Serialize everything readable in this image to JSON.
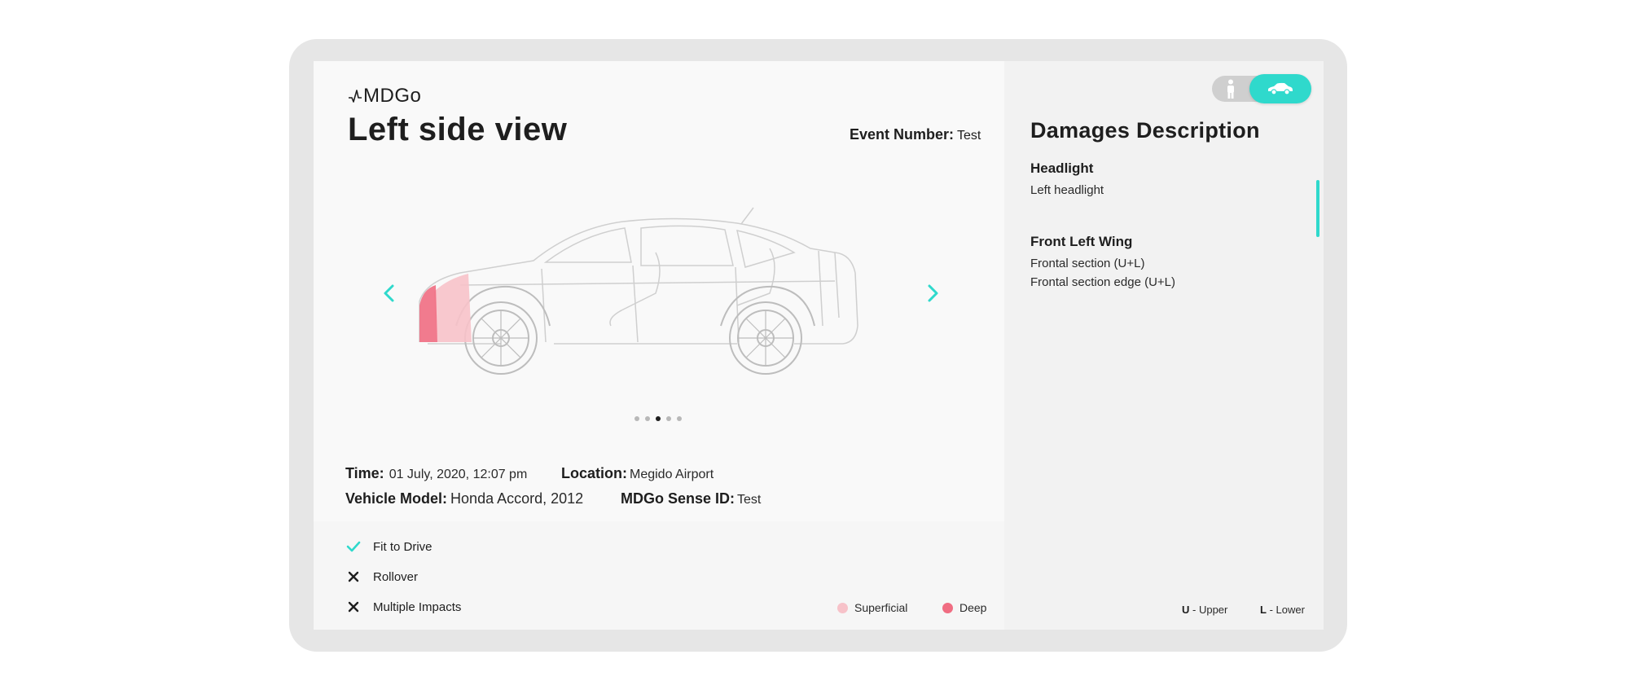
{
  "brand": {
    "logo_text": "MDGo"
  },
  "header": {
    "title": "Left side view",
    "event_label": "Event Number:",
    "event_value": "Test"
  },
  "carousel": {
    "prev_icon": "chevron-left-icon",
    "next_icon": "chevron-right-icon",
    "dots": 5,
    "active_dot": 3
  },
  "details": {
    "time_label": "Time:",
    "time_value": "01 July, 2020, 12:07 pm",
    "location_label": "Location:",
    "location_value": "Megido Airport",
    "vehicle_label": "Vehicle Model:",
    "vehicle_value": "Honda Accord, 2012",
    "sense_label": "MDGo Sense ID:",
    "sense_value": "Test"
  },
  "status_items": [
    {
      "label": "Fit to Drive",
      "icon": "check-icon"
    },
    {
      "label": "Rollover",
      "icon": "close-icon"
    },
    {
      "label": "Multiple Impacts",
      "icon": "close-icon"
    }
  ],
  "legend": {
    "superficial_label": "Superficial",
    "deep_label": "Deep",
    "superficial_color": "#f7c2c9",
    "deep_color": "#f06d82"
  },
  "toggle": {
    "left_icon": "person-icon",
    "right_icon": "car-icon",
    "active": "car"
  },
  "damages": {
    "title": "Damages Description",
    "groups": [
      {
        "heading": "Headlight",
        "lines": [
          "Left headlight"
        ]
      },
      {
        "heading": "Front Left Wing",
        "lines": [
          "Frontal section (U+L)",
          "Frontal section edge (U+L)"
        ]
      }
    ]
  },
  "key": {
    "upper_letter": "U",
    "upper_text": "- Upper",
    "lower_letter": "L",
    "lower_text": "- Lower"
  },
  "colors": {
    "accent": "#2fd9cc",
    "text": "#1e1e1e"
  }
}
